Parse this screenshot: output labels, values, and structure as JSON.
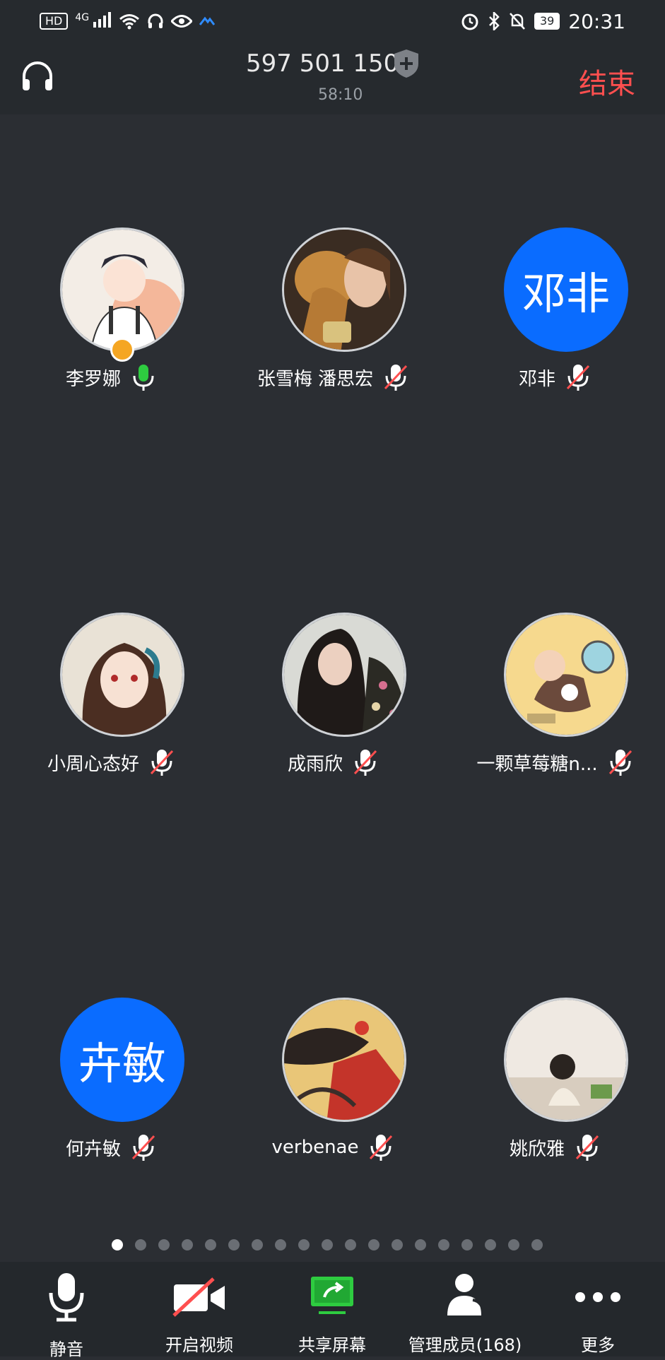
{
  "status_bar": {
    "left_icons": [
      "hd-icon",
      "4g-signal-icon",
      "wifi-icon",
      "headphone-icon",
      "eye-icon",
      "app-icon"
    ],
    "hd_label": "HD",
    "net_label": "4G",
    "right_icons": [
      "alarm-icon",
      "bluetooth-icon",
      "mute-bell-icon",
      "battery-icon"
    ],
    "battery": "39",
    "time": "20:31"
  },
  "header": {
    "meeting_id": "597 501 150",
    "elapsed": "58:10",
    "end_label": "结束"
  },
  "participants": [
    {
      "name": "李罗娜",
      "avatar_type": "image",
      "mic": "active",
      "host": true
    },
    {
      "name": "张雪梅  潘思宏",
      "avatar_type": "image",
      "mic": "muted",
      "host": false
    },
    {
      "name": "邓非",
      "avatar_type": "text",
      "avatar_text": "邓非",
      "mic": "muted",
      "host": false
    },
    {
      "name": "小周心态好",
      "avatar_type": "image",
      "mic": "muted",
      "host": false
    },
    {
      "name": "成雨欣",
      "avatar_type": "image",
      "mic": "muted",
      "host": false
    },
    {
      "name": "一颗草莓糖n...",
      "avatar_type": "image",
      "mic": "muted",
      "host": false
    },
    {
      "name": "何卉敏",
      "avatar_type": "text",
      "avatar_text": "卉敏",
      "mic": "muted",
      "host": false
    },
    {
      "name": "verbenae",
      "avatar_type": "image",
      "mic": "muted",
      "host": false
    },
    {
      "name": "姚欣雅",
      "avatar_type": "image",
      "mic": "muted",
      "host": false
    }
  ],
  "pagination": {
    "pages": 19,
    "current": 1
  },
  "toolbar": {
    "mute_label": "静音",
    "video_label": "开启视频",
    "share_label": "共享屏幕",
    "members_label": "管理成员(168)",
    "more_label": "更多"
  },
  "colors": {
    "accent_blue": "#0a6cff",
    "end_red": "#ff4f4f",
    "mic_green": "#2ecc40",
    "share_green": "#2ecc40",
    "bg": "#2b2e33"
  }
}
